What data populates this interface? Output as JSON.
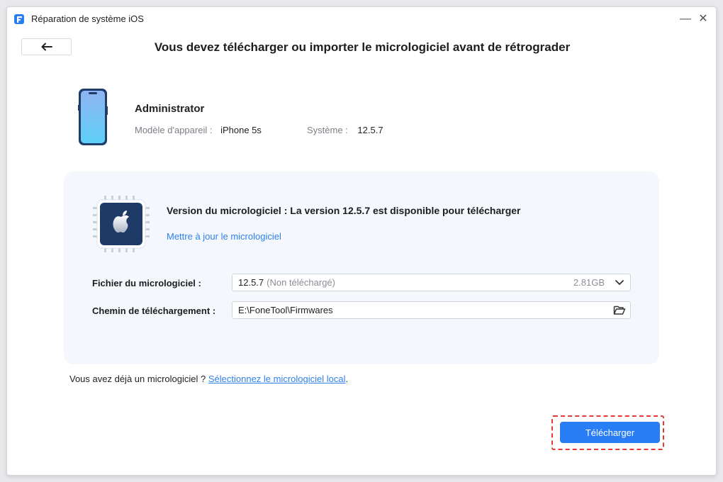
{
  "window": {
    "title": "Réparation de système iOS",
    "minimize_glyph": "—",
    "close_glyph": "✕"
  },
  "page": {
    "title": "Vous devez télécharger ou importer le micrologiciel avant de rétrograder"
  },
  "device": {
    "name": "Administrator",
    "model_label": "Modèle d'appareil :",
    "model_value": "iPhone 5s",
    "system_label": "Système :",
    "system_value": "12.5.7"
  },
  "firmware": {
    "title": "Version du micrologiciel : La version 12.5.7 est disponible pour télécharger",
    "update_link": "Mettre à jour le micrologiciel",
    "file_label": "Fichier du micrologiciel :",
    "file_value": "12.5.7",
    "file_status": "(Non téléchargé)",
    "file_size": "2.81GB",
    "path_label": "Chemin de téléchargement :",
    "path_value": "E:\\FoneTool\\Firmwares"
  },
  "local": {
    "prefix": "Vous avez déjà un micrologiciel ?",
    "link": "Sélectionnez le micrologiciel local",
    "suffix": "."
  },
  "actions": {
    "download_label": "Télécharger"
  },
  "colors": {
    "accent": "#2a7ef5",
    "link": "#2f80ed",
    "highlight": "#e53935",
    "panel_bg": "#f4f7fb",
    "chip_bg": "#1e3a66"
  },
  "icons": {
    "app": "app-logo-icon",
    "back": "arrow-left-icon",
    "phone": "iphone-icon",
    "chip": "apple-chip-icon",
    "dropdown": "chevron-down-icon",
    "folder": "folder-open-icon"
  }
}
